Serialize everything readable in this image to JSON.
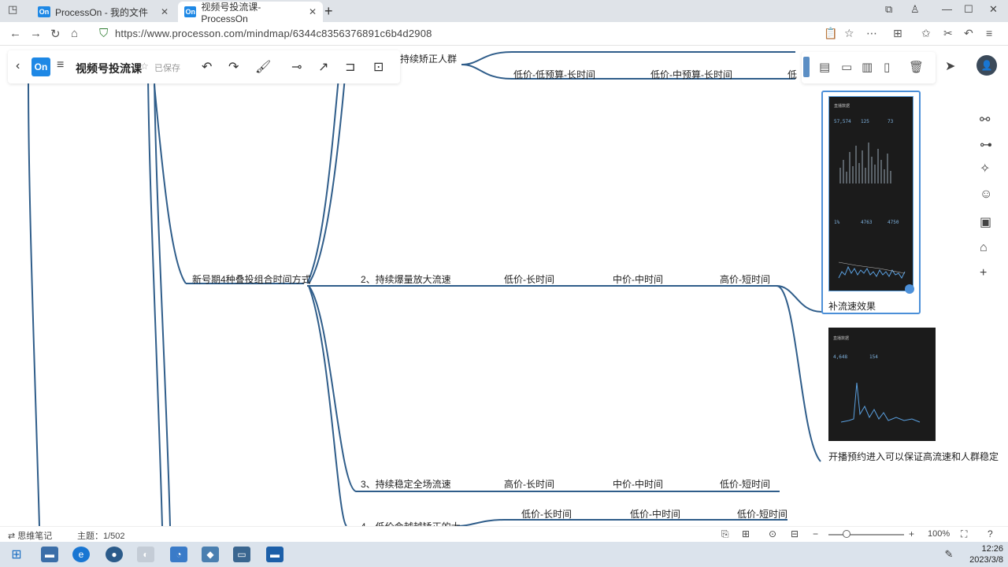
{
  "browser": {
    "tabs": [
      {
        "label": "ProcessOn - 我的文件"
      },
      {
        "label": "视频号投流课-ProcessOn"
      }
    ],
    "url": "https://www.processon.com/mindmap/6344c8356376891c6b4d2908"
  },
  "app": {
    "logo": "On",
    "title": "视频号投流课",
    "saved_status": "已保存"
  },
  "mindmap": {
    "nodes": {
      "top_branch": "持续矫正人群",
      "top_sub1": "低价-低预算-长时间",
      "top_sub2": "低价-中预算-长时间",
      "top_sub3": "低",
      "main": "新号期4种叠投组合时间方式",
      "b2": "2、持续爆量放大流速",
      "b2_s1": "低价-长时间",
      "b2_s2": "中价-中时间",
      "b2_s3": "高价-短时间",
      "b3": "3、持续稳定全场流速",
      "b3_s1": "高价-长时间",
      "b3_s2": "中价-中时间",
      "b3_s3": "低价-短时间",
      "b4": "4、低价会越越矫正的大",
      "b4_s1": "低价-长时间",
      "b4_s2": "低价-中时间",
      "b4_s3": "低价-短时间"
    },
    "images": {
      "caption1": "补流速效果",
      "caption2": "开播预约进入可以保证高流速和人群稳定",
      "card1_stats_top": [
        "57,574",
        "125",
        "73"
      ],
      "card1_stats_bottom": [
        "1%",
        "4763",
        "4750"
      ],
      "card2_stats": [
        "4,648",
        "154"
      ]
    }
  },
  "statusbar": {
    "notes": "⇄ 思维笔记",
    "topic_count": "主题：1/502",
    "zoom": "100%"
  },
  "taskbar": {
    "time": "12:26",
    "date": "2023/3/8"
  },
  "colors": {
    "accent": "#1e88e5",
    "line": "#2f5d8a",
    "card_border": "#4b8fd8"
  }
}
